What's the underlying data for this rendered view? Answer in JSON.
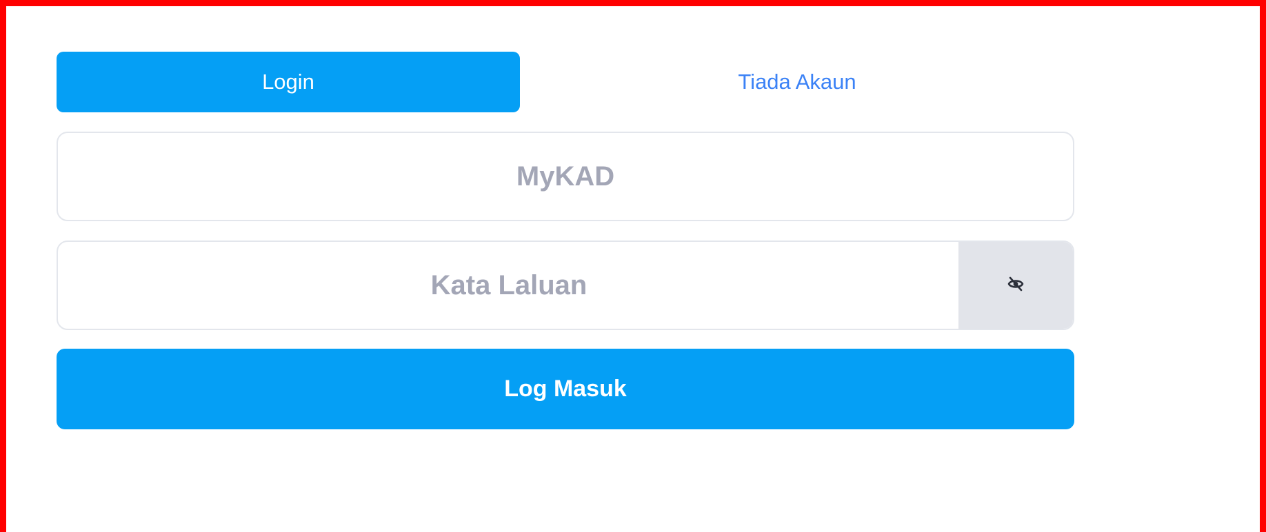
{
  "tabs": {
    "login_label": "Login",
    "no_account_label": "Tiada Akaun",
    "active": "login"
  },
  "form": {
    "mykad": {
      "value": "",
      "placeholder": "MyKAD"
    },
    "password": {
      "value": "",
      "placeholder": "Kata Laluan",
      "toggle_icon": "eye-slash-icon"
    },
    "submit_label": "Log Masuk"
  },
  "colors": {
    "accent": "#059ff5",
    "frame_border": "#ff0000",
    "link": "#3b82f6",
    "placeholder": "#a3a6b6",
    "toggle_bg": "#e2e4ea"
  }
}
